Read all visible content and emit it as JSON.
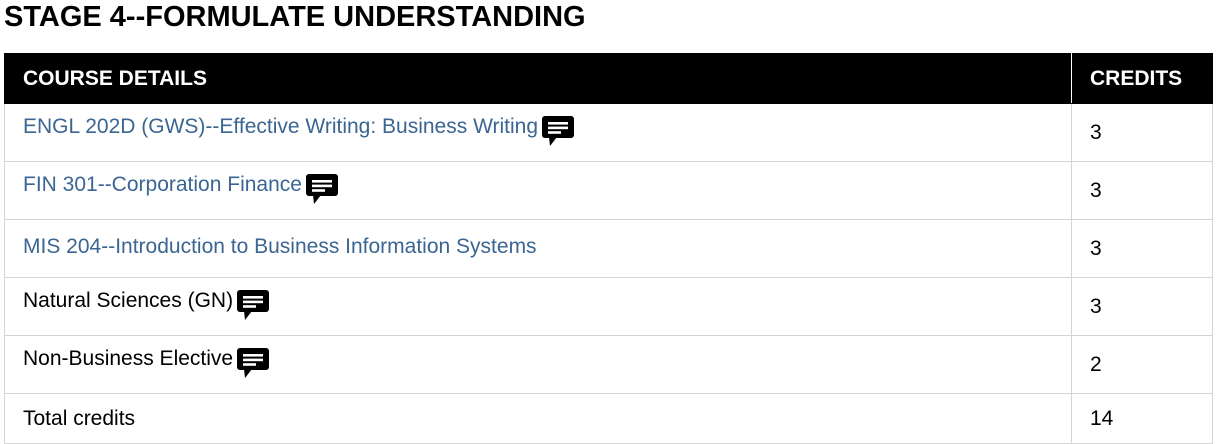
{
  "page": {
    "title": "STAGE 4--FORMULATE UNDERSTANDING"
  },
  "table": {
    "headers": {
      "details": "COURSE DETAILS",
      "credits": "CREDITS"
    },
    "rows": [
      {
        "label": "ENGL 202D (GWS)--Effective Writing: Business Writing",
        "link": true,
        "note_icon": "comment-icon",
        "credits": "3"
      },
      {
        "label": "FIN 301--Corporation Finance",
        "link": true,
        "note_icon": "comment-icon",
        "credits": "3"
      },
      {
        "label": "MIS 204--Introduction to Business Information Systems",
        "link": true,
        "note_icon": null,
        "credits": "3"
      },
      {
        "label": "Natural Sciences (GN)",
        "link": false,
        "note_icon": "comment-icon",
        "credits": "3"
      },
      {
        "label": "Non-Business Elective",
        "link": false,
        "note_icon": "comment-icon",
        "credits": "2"
      }
    ],
    "total": {
      "label": "Total credits",
      "credits": "14"
    }
  },
  "colors": {
    "link": "#3b6593",
    "header_bg": "#000000",
    "border": "#d4d4d4"
  }
}
